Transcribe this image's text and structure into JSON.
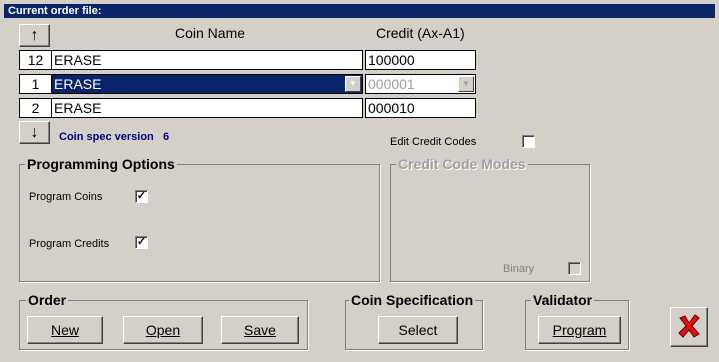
{
  "title": "Current order file:",
  "table": {
    "col_coin_name": "Coin Name",
    "col_credit": "Credit (Ax-A1)",
    "rows": [
      {
        "index": "12",
        "name": "ERASE",
        "credit": "100000"
      },
      {
        "index": "1",
        "name": "ERASE",
        "credit": "000001"
      },
      {
        "index": "2",
        "name": "ERASE",
        "credit": "000010"
      }
    ],
    "up_arrow": "↑",
    "down_arrow": "↓"
  },
  "coin_spec_version_label": "Coin spec version",
  "coin_spec_version_value": "6",
  "edit_credit_codes_label": "Edit Credit Codes",
  "programming_options": {
    "title": "Programming Options",
    "program_coins_label": "Program Coins",
    "program_coins_checked": true,
    "program_credits_label": "Program Credits",
    "program_credits_checked": true
  },
  "credit_code_modes": {
    "title": "Credit Code Modes",
    "binary_label": "Binary"
  },
  "order": {
    "title": "Order",
    "new_label": "New",
    "open_label": "Open",
    "save_label": "Save"
  },
  "coin_specification": {
    "title": "Coin Specification",
    "select_label": "Select"
  },
  "validator": {
    "title": "Validator",
    "program_label": "Program"
  },
  "close_icon": "red-x-icon",
  "colors": {
    "title_bar": "#0a246a",
    "selection": "#0a246a",
    "version_text": "#000080",
    "close_red": "#e01010"
  }
}
